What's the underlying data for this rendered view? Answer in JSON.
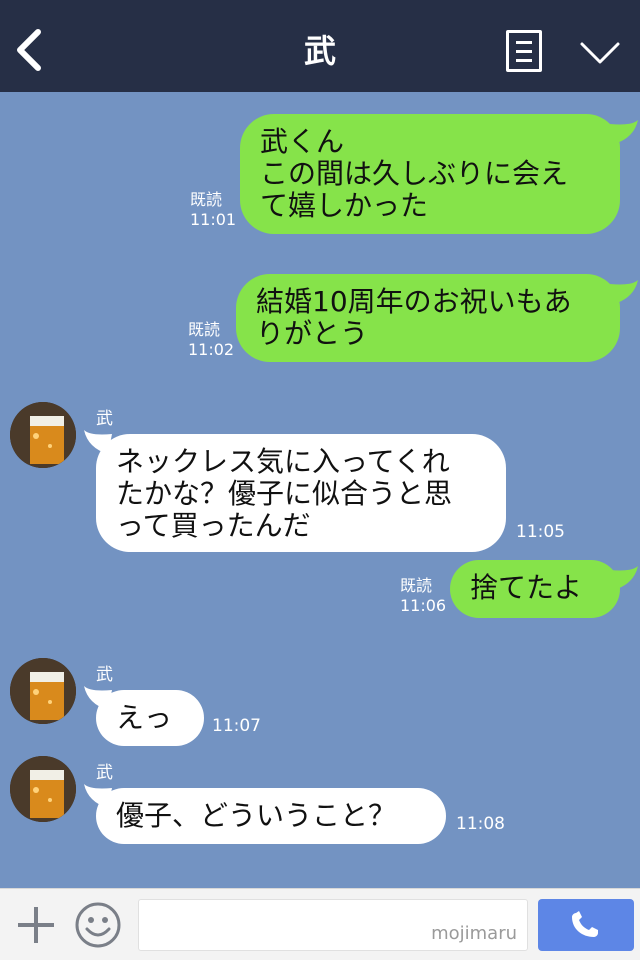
{
  "header": {
    "title": "武",
    "back_icon": "back-chevron-icon",
    "menu_icon": "note-list-icon",
    "dropdown_icon": "chevron-down-icon"
  },
  "colors": {
    "header_bg": "#262f46",
    "chat_bg": "#7393c2",
    "outgoing_bubble": "#86e34a",
    "incoming_bubble": "#ffffff",
    "call_button": "#5d86e6"
  },
  "messages": [
    {
      "direction": "outgoing",
      "text": "武くん\nこの間は久しぶりに会え\nて嬉しかった",
      "read_label": "既読",
      "time": "11:01"
    },
    {
      "direction": "outgoing",
      "text": "結婚10周年のお祝いもあ\nりがとう",
      "read_label": "既読",
      "time": "11:02"
    },
    {
      "direction": "incoming",
      "sender": "武",
      "text": "ネックレス気に入ってくれ\nたかな？優子に似合うと思\nって買ったんだ",
      "time": "11:05"
    },
    {
      "direction": "outgoing",
      "text": "捨てたよ",
      "read_label": "既読",
      "time": "11:06"
    },
    {
      "direction": "incoming",
      "sender": "武",
      "text": "えっ",
      "time": "11:07"
    },
    {
      "direction": "incoming",
      "sender": "武",
      "text": "優子、どういうこと？",
      "time": "11:08"
    }
  ],
  "footer": {
    "input_value": "",
    "watermark": "mojimaru",
    "add_icon": "plus-icon",
    "emoji_icon": "smiley-icon",
    "call_icon": "phone-icon"
  }
}
